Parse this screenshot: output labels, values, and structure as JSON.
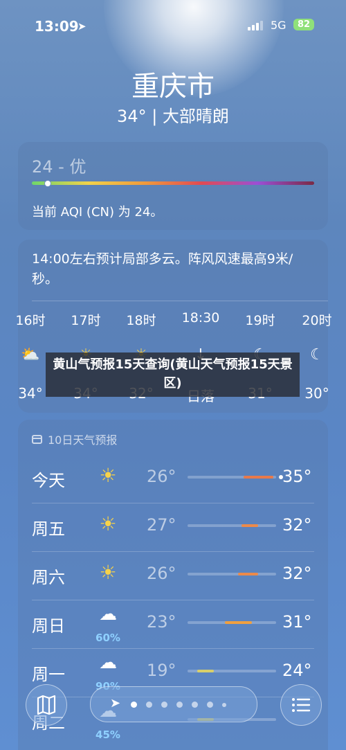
{
  "status": {
    "time": "13:09",
    "network": "5G",
    "battery": "82"
  },
  "header": {
    "city": "重庆市",
    "condition": "34° | 大部晴朗"
  },
  "aqi": {
    "value_label": "24 - 优",
    "description": "当前 AQI (CN) 为 24。",
    "value": 24
  },
  "hourly": {
    "description": "14:00左右预计局部多云。阵风风速最高9米/秒。",
    "items": [
      {
        "label": "16时",
        "icon": "cloud-sun-icon",
        "temp": "34°"
      },
      {
        "label": "17时",
        "icon": "sun-icon",
        "temp": "34°"
      },
      {
        "label": "18时",
        "icon": "sun-icon",
        "temp": "32°"
      },
      {
        "label": "18:30",
        "icon": "sunset-icon",
        "temp": "日落"
      },
      {
        "label": "19时",
        "icon": "moon-stars-icon",
        "temp": "31°"
      },
      {
        "label": "20时",
        "icon": "moon-icon",
        "temp": "30°"
      }
    ]
  },
  "banner": {
    "text": "黄山气预报15天查询(黄山天气预报15天景区)"
  },
  "daily": {
    "header": "10日天气预报",
    "rows": [
      {
        "day": "今天",
        "icon": "sun-icon",
        "precip": "",
        "low": "26°",
        "high": "35°",
        "low_num": 26,
        "high_num": 35,
        "current": 34,
        "color": "#e8794a"
      },
      {
        "day": "周五",
        "icon": "sun-icon",
        "precip": "",
        "low": "27°",
        "high": "32°",
        "low_num": 27,
        "high_num": 32,
        "color": "#ec8a4a"
      },
      {
        "day": "周六",
        "icon": "sun-icon",
        "precip": "",
        "low": "26°",
        "high": "32°",
        "low_num": 26,
        "high_num": 32,
        "color": "#ec8a4a"
      },
      {
        "day": "周日",
        "icon": "cloud-rain-icon",
        "precip": "60%",
        "low": "23°",
        "high": "31°",
        "low_num": 23,
        "high_num": 31,
        "color": "#f0a040"
      },
      {
        "day": "周一",
        "icon": "cloud-rain-icon",
        "precip": "90%",
        "low": "19°",
        "high": "24°",
        "low_num": 19,
        "high_num": 24,
        "color": "#d8cf6a"
      },
      {
        "day": "周二",
        "icon": "cloud-rain-icon",
        "precip": "45%",
        "low": "",
        "high": "",
        "low_num": 19,
        "high_num": 24,
        "color": "#d8cf6a"
      }
    ],
    "range": [
      19,
      35
    ]
  },
  "tabbar": {
    "map": "map-icon",
    "list": "list-icon",
    "page_count": 7,
    "active_page": 1
  }
}
